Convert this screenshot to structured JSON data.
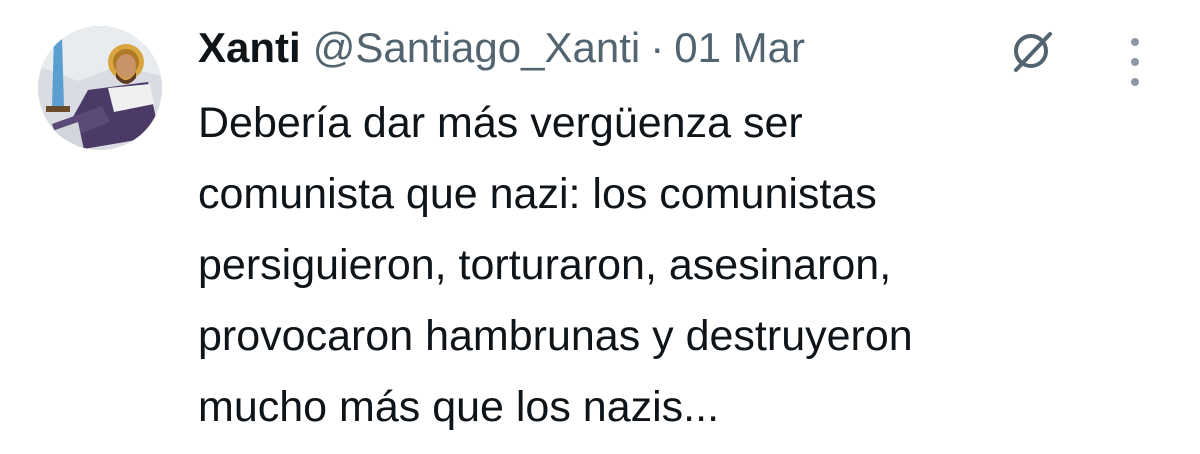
{
  "author": {
    "display_name": "Xanti",
    "handle": "@Santiago_Xanti",
    "separator": "·",
    "date": "01 Mar"
  },
  "tweet": {
    "text": "Debería dar más vergüenza ser\ncomunista que nazi: los comunistas\npersiguieron, torturaron, asesinaron,\nprovocaron hambrunas y destruyeron\nmucho más que los nazis..."
  },
  "icons": {
    "avatar": "avatar-knight-illustration",
    "grok": "grok-slash-circle-icon",
    "more": "vertical-ellipsis-icon"
  },
  "colors": {
    "text_primary": "#0f1419",
    "text_secondary": "#536471",
    "background": "#ffffff"
  }
}
